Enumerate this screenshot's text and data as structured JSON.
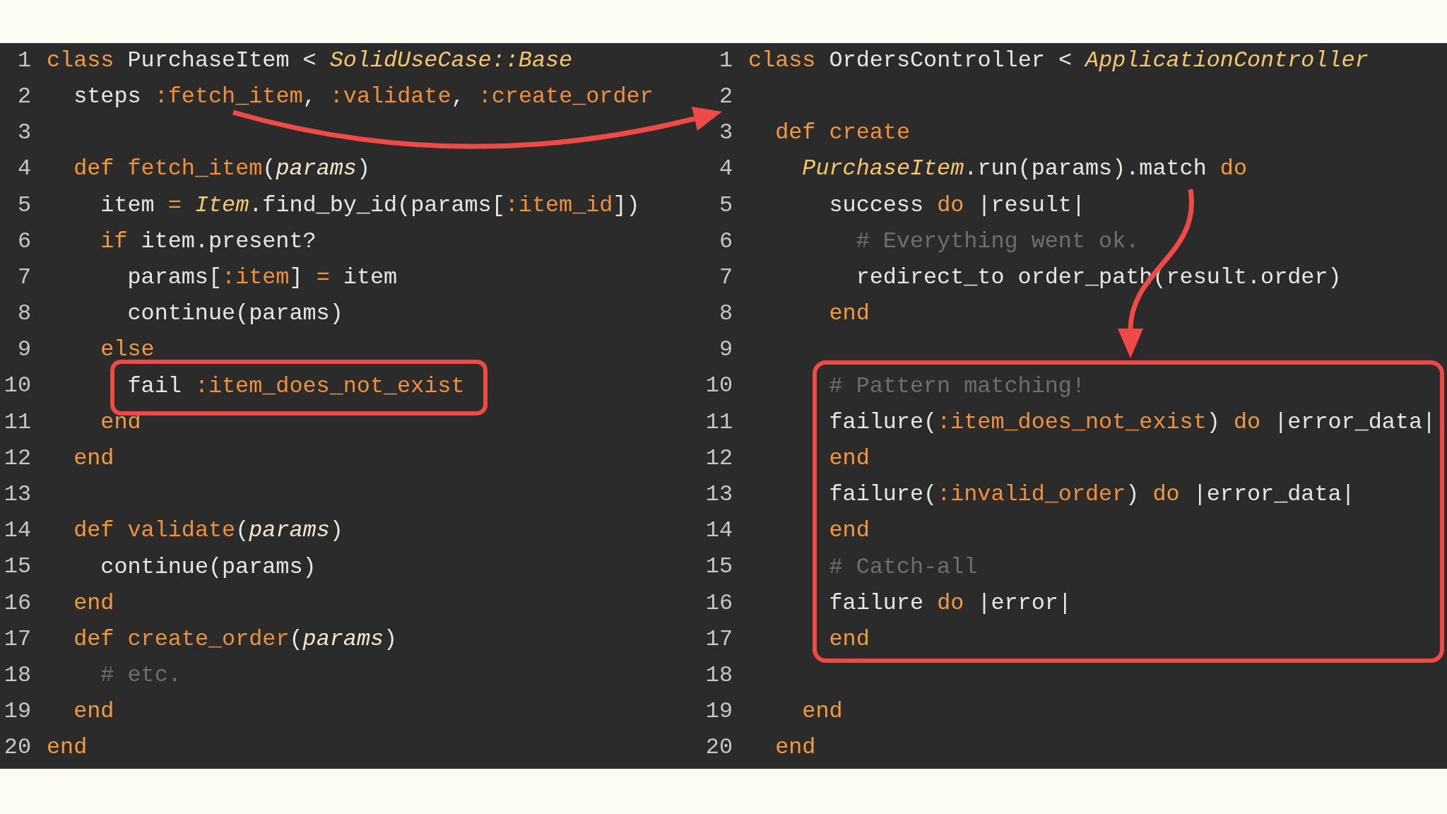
{
  "panes": [
    {
      "lines": [
        {
          "number": "1",
          "tokens": [
            {
              "text": "class ",
              "kind": "keyword"
            },
            {
              "text": "PurchaseItem < ",
              "kind": "plain"
            },
            {
              "text": "SolidUseCase::Base",
              "kind": "constant"
            }
          ],
          "children": [
            {
              "number": "2",
              "tokens": [
                {
                  "text": "steps ",
                  "kind": "plain"
                },
                {
                  "text": ":fetch_item",
                  "kind": "symbol"
                },
                {
                  "text": ", ",
                  "kind": "plain"
                },
                {
                  "text": ":validate",
                  "kind": "symbol"
                },
                {
                  "text": ", ",
                  "kind": "plain"
                },
                {
                  "text": ":create_order",
                  "kind": "symbol"
                }
              ]
            },
            {
              "number": "3"
            },
            {
              "number": "4",
              "tokens": [
                {
                  "text": "def ",
                  "kind": "keyword"
                },
                {
                  "text": "fetch_item",
                  "kind": "name"
                },
                {
                  "text": "(",
                  "kind": "plain"
                },
                {
                  "text": "params",
                  "kind": "param"
                },
                {
                  "text": ")",
                  "kind": "plain"
                }
              ],
              "children": [
                {
                  "number": "5",
                  "tokens": [
                    {
                      "text": "item ",
                      "kind": "plain"
                    },
                    {
                      "text": "= ",
                      "kind": "keyword"
                    },
                    {
                      "text": "Item",
                      "kind": "constant"
                    },
                    {
                      "text": ".find_by_id(params[",
                      "kind": "plain"
                    },
                    {
                      "text": ":item_id",
                      "kind": "symbol"
                    },
                    {
                      "text": "])",
                      "kind": "plain"
                    }
                  ]
                },
                {
                  "number": "6",
                  "tokens": [
                    {
                      "text": "if ",
                      "kind": "keyword"
                    },
                    {
                      "text": "item.present?",
                      "kind": "plain"
                    }
                  ],
                  "children": [
                    {
                      "number": "7",
                      "tokens": [
                        {
                          "text": "params[",
                          "kind": "plain"
                        },
                        {
                          "text": ":item",
                          "kind": "symbol"
                        },
                        {
                          "text": "] ",
                          "kind": "plain"
                        },
                        {
                          "text": "= ",
                          "kind": "keyword"
                        },
                        {
                          "text": "item",
                          "kind": "plain"
                        }
                      ]
                    },
                    {
                      "number": "8",
                      "tokens": [
                        {
                          "text": "continue(params)",
                          "kind": "plain"
                        }
                      ]
                    }
                  ]
                },
                {
                  "number": "9",
                  "tokens": [
                    {
                      "text": "else",
                      "kind": "keyword"
                    }
                  ],
                  "children": [
                    {
                      "number": "10",
                      "tokens": [
                        {
                          "text": "fail ",
                          "kind": "plain"
                        },
                        {
                          "text": ":item_does_not_exist",
                          "kind": "symbol"
                        }
                      ]
                    }
                  ]
                },
                {
                  "number": "11",
                  "tokens": [
                    {
                      "text": "end",
                      "kind": "keyword"
                    }
                  ]
                }
              ]
            },
            {
              "number": "12",
              "tokens": [
                {
                  "text": "end",
                  "kind": "keyword"
                }
              ]
            },
            {
              "number": "13"
            },
            {
              "number": "14",
              "tokens": [
                {
                  "text": "def ",
                  "kind": "keyword"
                },
                {
                  "text": "validate",
                  "kind": "name"
                },
                {
                  "text": "(",
                  "kind": "plain"
                },
                {
                  "text": "params",
                  "kind": "param"
                },
                {
                  "text": ")",
                  "kind": "plain"
                }
              ],
              "children": [
                {
                  "number": "15",
                  "tokens": [
                    {
                      "text": "continue(params)",
                      "kind": "plain"
                    }
                  ]
                }
              ]
            },
            {
              "number": "16",
              "tokens": [
                {
                  "text": "end",
                  "kind": "keyword"
                }
              ]
            },
            {
              "number": "17",
              "tokens": [
                {
                  "text": "def ",
                  "kind": "keyword"
                },
                {
                  "text": "create_order",
                  "kind": "name"
                },
                {
                  "text": "(",
                  "kind": "plain"
                },
                {
                  "text": "params",
                  "kind": "param"
                },
                {
                  "text": ")",
                  "kind": "plain"
                }
              ],
              "children": [
                {
                  "number": "18",
                  "tokens": [
                    {
                      "text": "# etc.",
                      "kind": "comment"
                    }
                  ]
                }
              ]
            },
            {
              "number": "19",
              "tokens": [
                {
                  "text": "end",
                  "kind": "keyword"
                }
              ]
            }
          ]
        },
        {
          "number": "20",
          "tokens": [
            {
              "text": "end",
              "kind": "keyword"
            }
          ]
        }
      ]
    },
    {
      "lines": [
        {
          "number": "1",
          "tokens": [
            {
              "text": "class ",
              "kind": "keyword"
            },
            {
              "text": "OrdersController < ",
              "kind": "plain"
            },
            {
              "text": "ApplicationController",
              "kind": "constant"
            }
          ],
          "children": [
            {
              "number": "2"
            },
            {
              "number": "3",
              "tokens": [
                {
                  "text": "def ",
                  "kind": "keyword"
                },
                {
                  "text": "create",
                  "kind": "name"
                }
              ],
              "children": [
                {
                  "number": "4",
                  "tokens": [
                    {
                      "text": "PurchaseItem",
                      "kind": "constant"
                    },
                    {
                      "text": ".run(params).match ",
                      "kind": "plain"
                    },
                    {
                      "text": "do",
                      "kind": "keyword"
                    }
                  ],
                  "children": [
                    {
                      "number": "5",
                      "tokens": [
                        {
                          "text": "success ",
                          "kind": "plain"
                        },
                        {
                          "text": "do",
                          "kind": "keyword"
                        },
                        {
                          "text": " |result|",
                          "kind": "plain"
                        }
                      ],
                      "children": [
                        {
                          "number": "6",
                          "tokens": [
                            {
                              "text": "# Everything went ok.",
                              "kind": "comment"
                            }
                          ]
                        },
                        {
                          "number": "7",
                          "tokens": [
                            {
                              "text": "redirect_to order_path(result.order)",
                              "kind": "plain"
                            }
                          ]
                        }
                      ]
                    },
                    {
                      "number": "8",
                      "tokens": [
                        {
                          "text": "end",
                          "kind": "keyword"
                        }
                      ]
                    },
                    {
                      "number": "9"
                    },
                    {
                      "number": "10",
                      "tokens": [
                        {
                          "text": "# Pattern matching!",
                          "kind": "comment"
                        }
                      ]
                    },
                    {
                      "number": "11",
                      "tokens": [
                        {
                          "text": "failure(",
                          "kind": "plain"
                        },
                        {
                          "text": ":item_does_not_exist",
                          "kind": "symbol"
                        },
                        {
                          "text": ") ",
                          "kind": "plain"
                        },
                        {
                          "text": "do",
                          "kind": "keyword"
                        },
                        {
                          "text": " |error_data|",
                          "kind": "plain"
                        }
                      ]
                    },
                    {
                      "number": "12",
                      "tokens": [
                        {
                          "text": "end",
                          "kind": "keyword"
                        }
                      ]
                    },
                    {
                      "number": "13",
                      "tokens": [
                        {
                          "text": "failure(",
                          "kind": "plain"
                        },
                        {
                          "text": ":invalid_order",
                          "kind": "symbol"
                        },
                        {
                          "text": ") ",
                          "kind": "plain"
                        },
                        {
                          "text": "do",
                          "kind": "keyword"
                        },
                        {
                          "text": " |error_data|",
                          "kind": "plain"
                        }
                      ]
                    },
                    {
                      "number": "14",
                      "tokens": [
                        {
                          "text": "end",
                          "kind": "keyword"
                        }
                      ]
                    },
                    {
                      "number": "15",
                      "tokens": [
                        {
                          "text": "# Catch-all",
                          "kind": "comment"
                        }
                      ]
                    },
                    {
                      "number": "16",
                      "tokens": [
                        {
                          "text": "failure ",
                          "kind": "plain"
                        },
                        {
                          "text": "do",
                          "kind": "keyword"
                        },
                        {
                          "text": " |error|",
                          "kind": "plain"
                        }
                      ]
                    },
                    {
                      "number": "17",
                      "tokens": [
                        {
                          "text": "end",
                          "kind": "keyword"
                        }
                      ]
                    },
                    {
                      "number": "18"
                    }
                  ]
                },
                {
                  "number": "19",
                  "tokens": [
                    {
                      "text": "end",
                      "kind": "keyword"
                    }
                  ]
                }
              ]
            },
            {
              "number": "20",
              "tokens": [
                {
                  "text": "end",
                  "kind": "keyword"
                }
              ]
            }
          ]
        }
      ]
    }
  ]
}
